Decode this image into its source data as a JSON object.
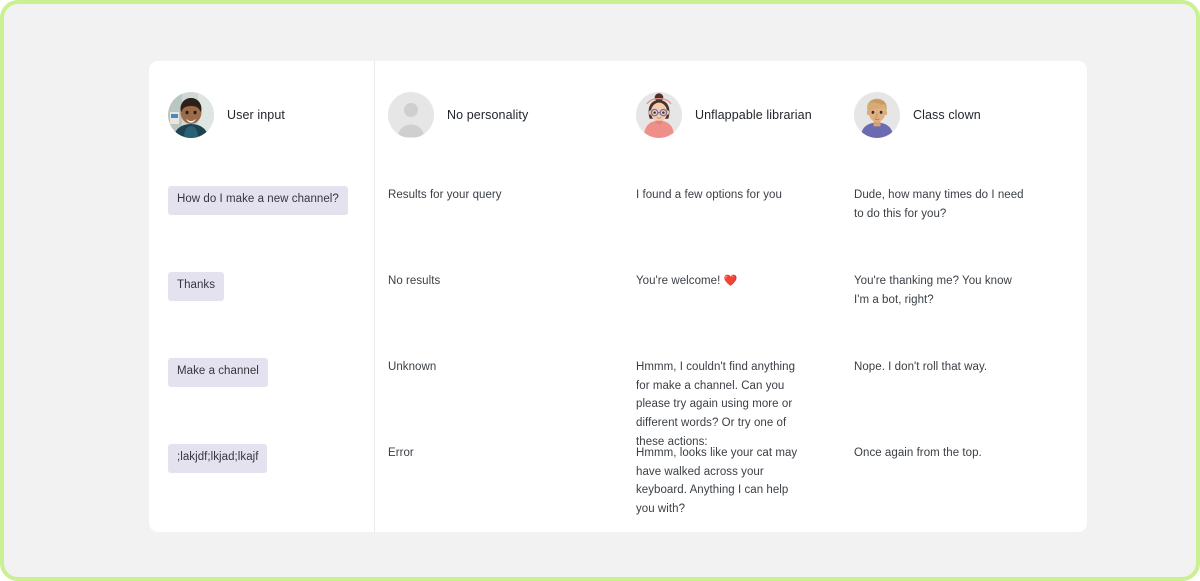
{
  "theme": {
    "frame_border_color": "#c9f191",
    "page_background": "#f2f2f2",
    "card_background": "#ffffff",
    "chip_background": "#e4e2ef",
    "chip_text_color": "#33373c",
    "reply_text_color": "#3b4046",
    "divider_color": "#eceaea",
    "heart_color": "#e5332a"
  },
  "columns": [
    {
      "id": "user-input",
      "label": "User input",
      "avatar_icon": "user-photo-avatar",
      "avatar_type": "photo"
    },
    {
      "id": "no-personality",
      "label": "No personality",
      "avatar_icon": "generic-person-avatar",
      "avatar_type": "placeholder"
    },
    {
      "id": "unflappable-librarian",
      "label": "Unflappable librarian",
      "avatar_icon": "librarian-avatar",
      "avatar_type": "illustration"
    },
    {
      "id": "class-clown",
      "label": "Class clown",
      "avatar_icon": "class-clown-avatar",
      "avatar_type": "illustration"
    }
  ],
  "rows": [
    {
      "user_input": "How do I make a new channel?",
      "no_personality": "Results for your query",
      "librarian": "I found a few options for you",
      "class_clown": "Dude, how many times do I need to do this for you?"
    },
    {
      "user_input": "Thanks",
      "no_personality": "No results",
      "librarian_prefix": "You're welcome! ",
      "librarian_emoji": "❤️",
      "class_clown": "You're thanking me? You know I'm a bot, right?"
    },
    {
      "user_input": "Make a channel",
      "no_personality": "Unknown",
      "librarian": "Hmmm, I couldn't find anything for make a channel. Can you please try again using more or different words? Or try one of these actions:",
      "class_clown": "Nope. I don't roll that way."
    },
    {
      "user_input": ";lakjdf;lkjad;lkajf",
      "no_personality": "Error",
      "librarian": "Hmmm, looks like your cat may have walked across your keyboard. Anything I can help you with?",
      "class_clown": "Once again from the top."
    }
  ]
}
